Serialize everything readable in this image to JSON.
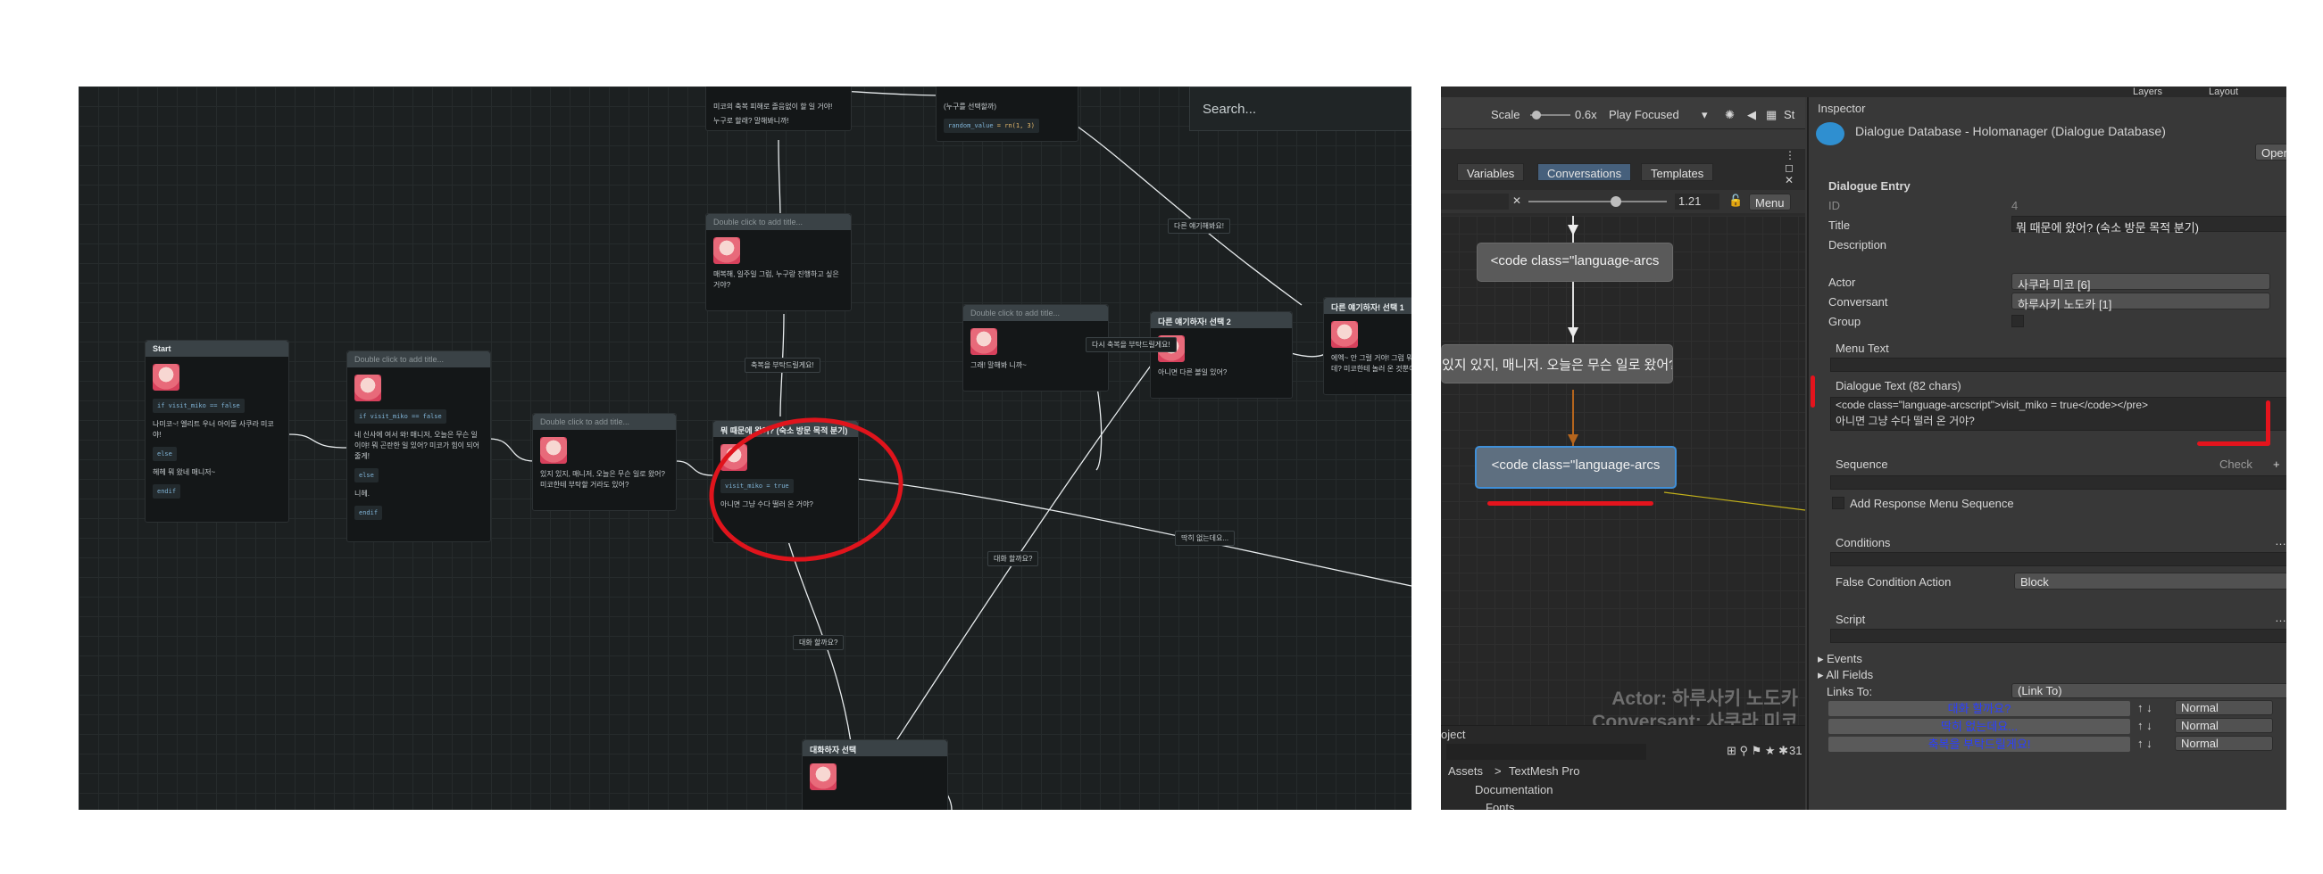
{
  "graph": {
    "search_placeholder": "Search...",
    "nodes": {
      "top_left": {
        "text1": "미코의 축복 피해로 졸음없이 할 일 거야!",
        "text2": "누구로 할래? 말해봐니까!"
      },
      "top_mid": {
        "title": "(누구를 선택할까)",
        "code_key": "random_value",
        "code_val": "= rn(1, 3)"
      },
      "placeholder_title": "Double click to add title...",
      "upper_center": {
        "text": "매복해, 일주일 그럼, 누구랑 진행하고 싶은 거야?"
      },
      "start": {
        "title": "Start",
        "code": "if visit_miko == false",
        "text1": "나미코~! 엘리트 우너 아이돌 사쿠라 미코야!",
        "else": "else",
        "text2": "헤헤 뭐 왔네 매니저~",
        "endif": "endif"
      },
      "node2": {
        "code": "if visit_miko == false",
        "text1": "네 신사에 여서 와! 매니저, 오늘은 무슨 일이야! 뭐 곤란한 일 있어? 미코가 힘이 되어줄게!",
        "else": "else",
        "text2": "니헤.",
        "endif": "endif"
      },
      "node3": {
        "text": "있지 있지, 매니저, 오늘은 무슨 일로 왔어? 미코한테 부탁할 거라도 있어?"
      },
      "selected": {
        "title": "뭐 때문에 왔어? (숙소 방문 목적 분기)",
        "code": "visit_miko = true",
        "text": "아니면 그냥 수다 떨러 온 거야?"
      },
      "right_mid": {
        "text": "그래! 말해봐 니까~"
      },
      "branch2": {
        "title": "다른 얘기하자! 선택 2",
        "text": "아니면 다른 볼일 있어?"
      },
      "branch1": {
        "title": "다른 얘기하자! 선택 1",
        "text": "에엑~ 안 그럴 거야! 그럼 뭐 하고 싶은데? 미코한테 놀러 온 것뿐이야?"
      },
      "bottom": {
        "title": "대화하자 선택"
      }
    },
    "edge_labels": {
      "e1": "축복을 부탁드릴게요!",
      "e2": "다른 얘기해봐요!",
      "e3": "다시 축복을 부탁드릴게요!",
      "e4": "딱히 없는데요...",
      "e5": "대화 할까요?",
      "e6": "대화 할까요?"
    }
  },
  "editor": {
    "toolbar": {
      "layers": "Layers",
      "layout": "Layout"
    },
    "topbar": {
      "scale": "Scale",
      "scale_val": "0.6x",
      "play": "Play Focused",
      "st": "St"
    },
    "tabs": [
      "Variables",
      "Conversations",
      "Templates"
    ],
    "zoom_value": "1.21",
    "menu": "Menu",
    "dnodes": [
      "<code class=\"language-arcs",
      "있지 있지, 매니저. 오늘은 무슨 일로 왔어?",
      "<code class=\"language-arcs"
    ],
    "actor_label": "Actor: 하루사키 노도카",
    "conversant_label": "Conversant: 사쿠라 미코",
    "project": {
      "tab": "oject",
      "assets": "Assets",
      "sep": ">",
      "folder": "TextMesh Pro",
      "item1": "Documentation",
      "item2": "Fonts",
      "count": "31"
    },
    "inspector": {
      "tab": "Inspector",
      "title": "Dialogue Database - Holomanager (Dialogue Database)",
      "open": "Open",
      "section": "Dialogue Entry",
      "id_label": "ID",
      "id_val": "4",
      "title_label": "Title",
      "title_val": "뭐 때문에 왔어? (숙소 방문 목적 분기)",
      "desc_label": "Description",
      "actor_label": "Actor",
      "actor_val": "사쿠라 미코 [6]",
      "conv_label": "Conversant",
      "conv_val": "하루사키 노도카 [1]",
      "group_label": "Group",
      "menu_text": "Menu Text",
      "dialogue_text": "Dialogue Text (82 chars)",
      "dialogue_line1": "<code class=\"language-arcscript\">visit_miko = true</code></pre>",
      "dialogue_line2": "아니면 그냥 수다 떨러 온 거야?",
      "sequence": "Sequence",
      "check": "Check",
      "add_resp": "Add Response Menu Sequence",
      "conditions": "Conditions",
      "false_action": "False Condition Action",
      "false_val": "Block",
      "script": "Script",
      "events": "Events",
      "all_fields": "All Fields",
      "links_to": "Links To:",
      "links_val": "(Link To)",
      "links": [
        "대화 할까요?",
        "딱히 없는데요...",
        "축복을 부탁드릴게요!"
      ],
      "normal": "Normal"
    }
  },
  "colors": {
    "annotation": "#e4141d",
    "link_text": "#2b3fff",
    "selection": "#3f8fd8"
  }
}
